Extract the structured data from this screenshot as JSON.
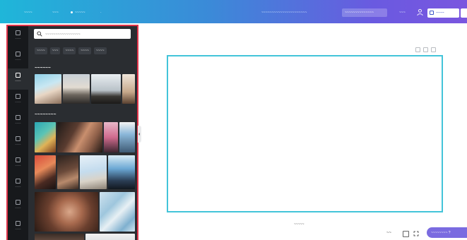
{
  "topbar": {
    "menu_label": "~~~~",
    "file_label": "~~~",
    "resize_label": "~~~~~",
    "separator": "·",
    "design_title": "~~~~~~~~~~~~~~~~~~~~~~",
    "upgrade_label": "~~~~~~~~~~~~~~",
    "count_label": "~~~",
    "share_label": "~~~~"
  },
  "rail": {
    "items": [
      {
        "label": "~~~~",
        "icon": "template-icon"
      },
      {
        "label": "~~~~",
        "icon": "elements-icon"
      },
      {
        "label": "~~~~",
        "icon": "photos-icon"
      },
      {
        "label": "~~~~",
        "icon": "uploads-icon"
      },
      {
        "label": "~~~~",
        "icon": "text-icon"
      },
      {
        "label": "~~~~",
        "icon": "styles-icon"
      },
      {
        "label": "~~~~",
        "icon": "videos-icon"
      },
      {
        "label": "~~~~",
        "icon": "audio-icon"
      },
      {
        "label": "~~~~",
        "icon": "background-icon"
      },
      {
        "label": "~~~~",
        "icon": "folders-icon"
      },
      {
        "label": "~~~~",
        "icon": "more-icon"
      }
    ],
    "active_index": 2
  },
  "panel": {
    "search_placeholder": "~~~~~~~~~~~~~~~~~",
    "chips": [
      "~~~~",
      "~~~",
      "~~~~",
      "~~~~",
      "~~~~"
    ],
    "section1_title": "~~~~~~",
    "section2_title": "~~~~~~~~"
  },
  "canvas": {
    "add_page_label": "~~~~~"
  },
  "bottombar": {
    "notes_label": "~~",
    "help_label": "~~~~~~~~ ?"
  },
  "colors": {
    "topbar_start": "#1fb6d9",
    "topbar_end": "#7a56df",
    "rail_bg": "#17191c",
    "panel_bg": "#2a2d31",
    "frame": "#e0344a",
    "canvas_border": "#43c4d9",
    "help_button": "#7a6be0"
  }
}
